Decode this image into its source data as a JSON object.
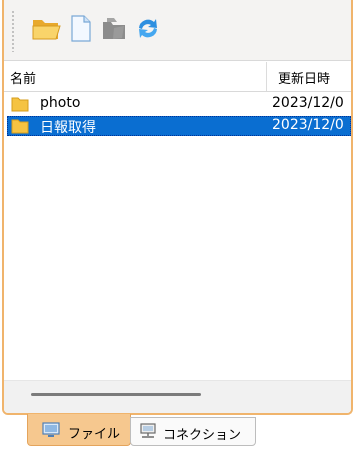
{
  "toolbar": {
    "buttons": [
      {
        "icon": "open-folder-icon"
      },
      {
        "icon": "new-file-icon"
      },
      {
        "icon": "disabled-folder-icon"
      },
      {
        "icon": "refresh-icon"
      }
    ]
  },
  "list": {
    "columns": {
      "name": "名前",
      "date": "更新日時"
    },
    "rows": [
      {
        "name": "photo",
        "date": "2023/12/0",
        "icon": "folder-icon",
        "selected": false
      },
      {
        "name": "日報取得",
        "date": "2023/12/0",
        "icon": "folder-icon",
        "selected": true
      }
    ]
  },
  "tabs": [
    {
      "label": "ファイル",
      "icon": "computer-icon",
      "active": true
    },
    {
      "label": "コネクション",
      "icon": "network-icon",
      "active": false
    }
  ],
  "colors": {
    "accent_border": "#f0b46c",
    "selection": "#0a6ed1",
    "active_tab": "#f6c88f"
  }
}
